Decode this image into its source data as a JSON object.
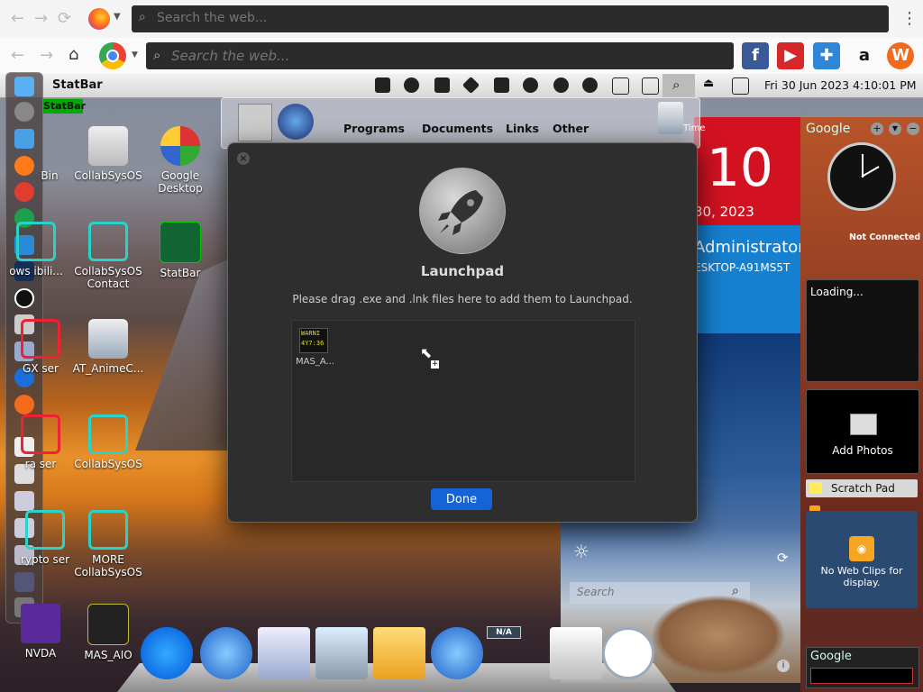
{
  "browser": {
    "search_placeholder_top": "Search the web...",
    "search_placeholder_main": "Search the web...",
    "menu_glyph": "⋮"
  },
  "statbar": {
    "title": "StatBar",
    "datetime": "Fri 30 Jun 2023 4:10:01 PM",
    "label_small": "StatBar"
  },
  "desktop_icons": [
    {
      "label": "Bin"
    },
    {
      "label": "CollabSysOS"
    },
    {
      "label": "Google Desktop"
    },
    {
      "label": "ows ibili..."
    },
    {
      "label": "CollabSysOS Contact"
    },
    {
      "label": "StatBar"
    },
    {
      "label": "GX ser"
    },
    {
      "label": "AT_AnimeC..."
    },
    {
      "label": "ra ser"
    },
    {
      "label": "CollabSysOS"
    },
    {
      "label": "rypto ser"
    },
    {
      "label": "MORE CollabSysOS"
    },
    {
      "label": "NVDA"
    },
    {
      "label": "MAS_AIO"
    }
  ],
  "launchpad_strip": {
    "tabs": [
      "Programs",
      "Documents",
      "Links",
      "Other"
    ],
    "time_label": "Time"
  },
  "dialog": {
    "title": "Launchpad",
    "hint": "Please drag .exe and .lnk files here to add them to Launchpad.",
    "item_label": "MAS_A...",
    "item_badge": "WARNI",
    "item_badge2": "4Y7:36",
    "done_label": "Done",
    "close_glyph": "×"
  },
  "tiles": {
    "day_number": "10",
    "date_line": "30, 2023",
    "user_name": "Administrator",
    "computer_name": "ESKTOP-A91MS5T"
  },
  "weather": {
    "search_placeholder": "Search"
  },
  "gadgets": {
    "google_label": "Google",
    "clock_status": "Not Connected",
    "loading_text": "Loading...",
    "add_photos": "Add Photos",
    "scratch_pad": "Scratch Pad",
    "web_clips": "No Web Clips for display.",
    "google_bottom": "Google"
  },
  "dock": {
    "na_badge": "N/A"
  },
  "colors": {
    "accent_blue": "#1463d7",
    "tile_red": "#d31221",
    "tile_blue": "#1680d0",
    "ring_teal": "#2ad3c7"
  }
}
